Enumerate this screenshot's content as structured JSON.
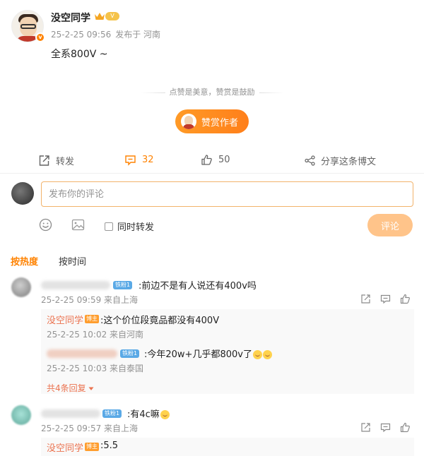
{
  "post": {
    "username": "没空同学",
    "vip_label": "V",
    "timestamp": "25-2-25 09:56",
    "location": "发布于 河南",
    "text": "全系800V ~"
  },
  "reward": {
    "tagline": "点赞是美意，赞赏是鼓励",
    "button_label": "赞赏作者"
  },
  "actions": {
    "repost_label": "转发",
    "comment_count": "32",
    "like_count": "50",
    "share_label": "分享这条博文"
  },
  "composer": {
    "placeholder": "发布你的评论",
    "repost_option": "同时转发",
    "submit_label": "评论"
  },
  "sort": {
    "hot": "按热度",
    "time": "按时间"
  },
  "comments": [
    {
      "fan_badge": "铁粉1",
      "text": ":前边不是有人说还有400v吗",
      "time": "25-2-25 09:59 来自上海",
      "replies": [
        {
          "name": "没空同学",
          "badge": "博主",
          "text": ":这个价位段竟品都没有400V",
          "time": "25-2-25 10:02 来自河南"
        },
        {
          "fan_badge": "铁粉1",
          "text": ":今年20w+几乎都800v了",
          "time": "25-2-25 10:03 来自泰国"
        }
      ],
      "more_replies": "共4条回复"
    },
    {
      "fan_badge": "铁粉1",
      "text": ":有4c嘛",
      "time": "25-2-25 09:57 来自上海",
      "replies": [
        {
          "name": "没空同学",
          "badge": "博主",
          "text": ":5.5"
        }
      ]
    }
  ],
  "colors": {
    "accent": "#ff8200",
    "name_link": "#eb7350",
    "muted": "#939393"
  }
}
